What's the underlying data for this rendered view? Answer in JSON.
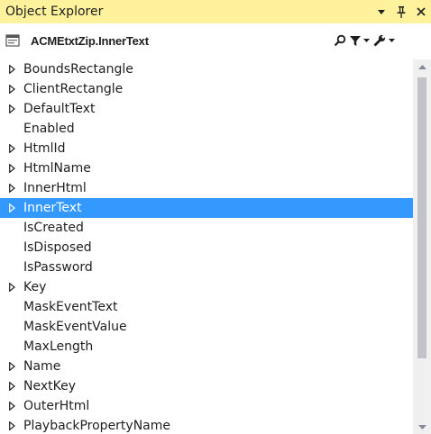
{
  "titlebar": {
    "title": "Object Explorer",
    "dropdown_icon": "chevron-down-icon",
    "pin_icon": "pin-icon",
    "close_icon": "close-icon"
  },
  "toolbar": {
    "object_icon": "control-object-icon",
    "object_name": "ACMEtxtZip.InnerText",
    "tools": [
      "search-icon",
      "filter-icon",
      "wrench-icon"
    ]
  },
  "properties": [
    {
      "label": "BoundsRectangle",
      "expandable": true,
      "selected": false
    },
    {
      "label": "ClientRectangle",
      "expandable": true,
      "selected": false
    },
    {
      "label": "DefaultText",
      "expandable": true,
      "selected": false
    },
    {
      "label": "Enabled",
      "expandable": false,
      "selected": false
    },
    {
      "label": "HtmlId",
      "expandable": true,
      "selected": false
    },
    {
      "label": "HtmlName",
      "expandable": true,
      "selected": false
    },
    {
      "label": "InnerHtml",
      "expandable": true,
      "selected": false
    },
    {
      "label": "InnerText",
      "expandable": true,
      "selected": true
    },
    {
      "label": "IsCreated",
      "expandable": false,
      "selected": false
    },
    {
      "label": "IsDisposed",
      "expandable": false,
      "selected": false
    },
    {
      "label": "IsPassword",
      "expandable": false,
      "selected": false
    },
    {
      "label": "Key",
      "expandable": true,
      "selected": false
    },
    {
      "label": "MaskEventText",
      "expandable": false,
      "selected": false
    },
    {
      "label": "MaskEventValue",
      "expandable": false,
      "selected": false
    },
    {
      "label": "MaxLength",
      "expandable": false,
      "selected": false
    },
    {
      "label": "Name",
      "expandable": true,
      "selected": false
    },
    {
      "label": "NextKey",
      "expandable": true,
      "selected": false
    },
    {
      "label": "OuterHtml",
      "expandable": true,
      "selected": false
    },
    {
      "label": "PlaybackPropertyName",
      "expandable": true,
      "selected": false
    }
  ],
  "colors": {
    "titlebar_bg": "#fff29d",
    "selection_bg": "#3399ff",
    "scroll_thumb": "#c2c3c9"
  }
}
